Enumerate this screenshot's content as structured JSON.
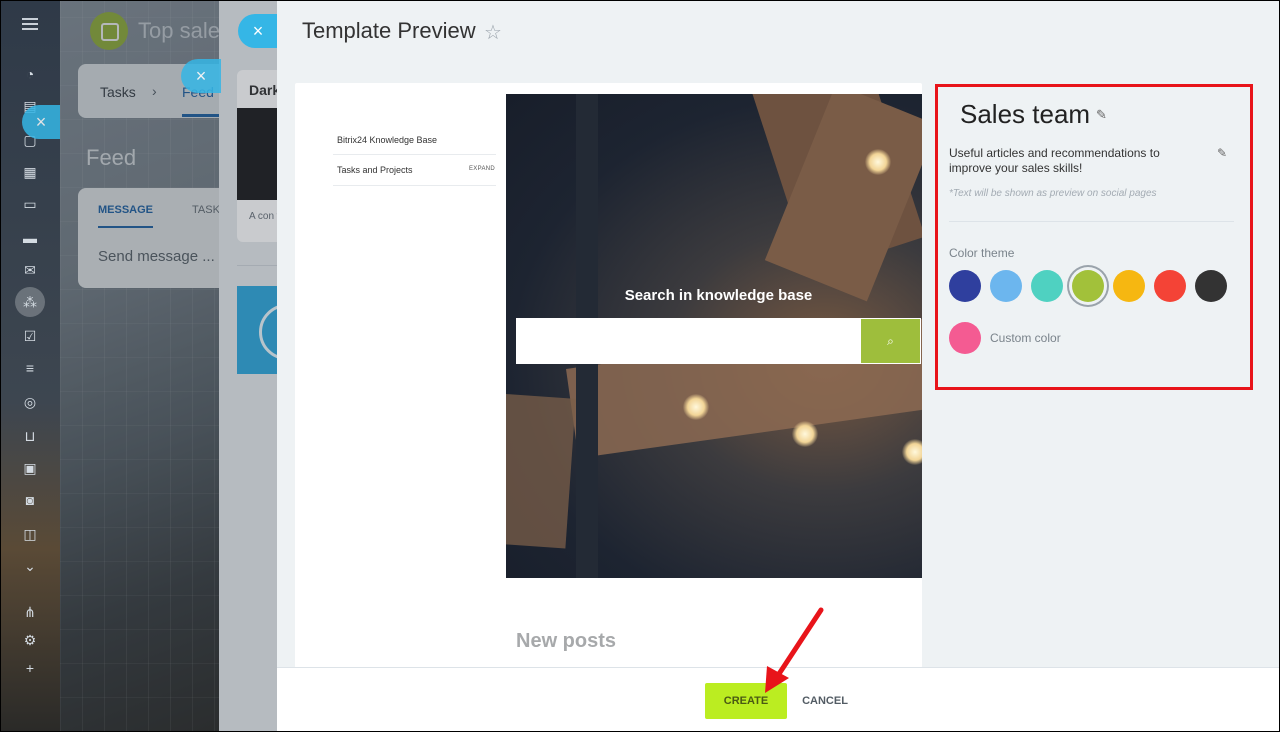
{
  "background": {
    "app_title": "Top sales",
    "breadcrumb": {
      "tasks": "Tasks",
      "separator": "›",
      "feed": "Feed"
    },
    "feed_title": "Feed",
    "composer": {
      "tab_message": "MESSAGE",
      "tab_tasks": "TASK",
      "placeholder": "Send message ..."
    },
    "template_card": {
      "title": "Dark",
      "description": "A con with a"
    }
  },
  "close_icon": "×",
  "template_preview": {
    "title": "Template Preview",
    "star_icon": "☆",
    "preview": {
      "sidebar_items": [
        {
          "label": "Bitrix24 Knowledge Base"
        },
        {
          "label": "Tasks and Projects",
          "action": "EXPAND"
        }
      ],
      "hero_heading": "Search in knowledge base",
      "search_icon": "⌕",
      "section_heading": "New posts"
    },
    "settings": {
      "name": "Sales team",
      "edit_icon": "✎",
      "description": "Useful articles and recommendations to improve your sales skills!",
      "note": "*Text will be shown as preview on social pages",
      "color_theme_label": "Color theme",
      "colors": [
        "#2f3f9e",
        "#6cb6ee",
        "#4fd1c1",
        "#a2c13a",
        "#f6b711",
        "#f44336",
        "#333333"
      ],
      "selected_color": "#a2c13a",
      "custom_color": "#f45b92",
      "custom_color_label": "Custom color"
    },
    "footer": {
      "create": "CREATE",
      "cancel": "CANCEL"
    }
  }
}
